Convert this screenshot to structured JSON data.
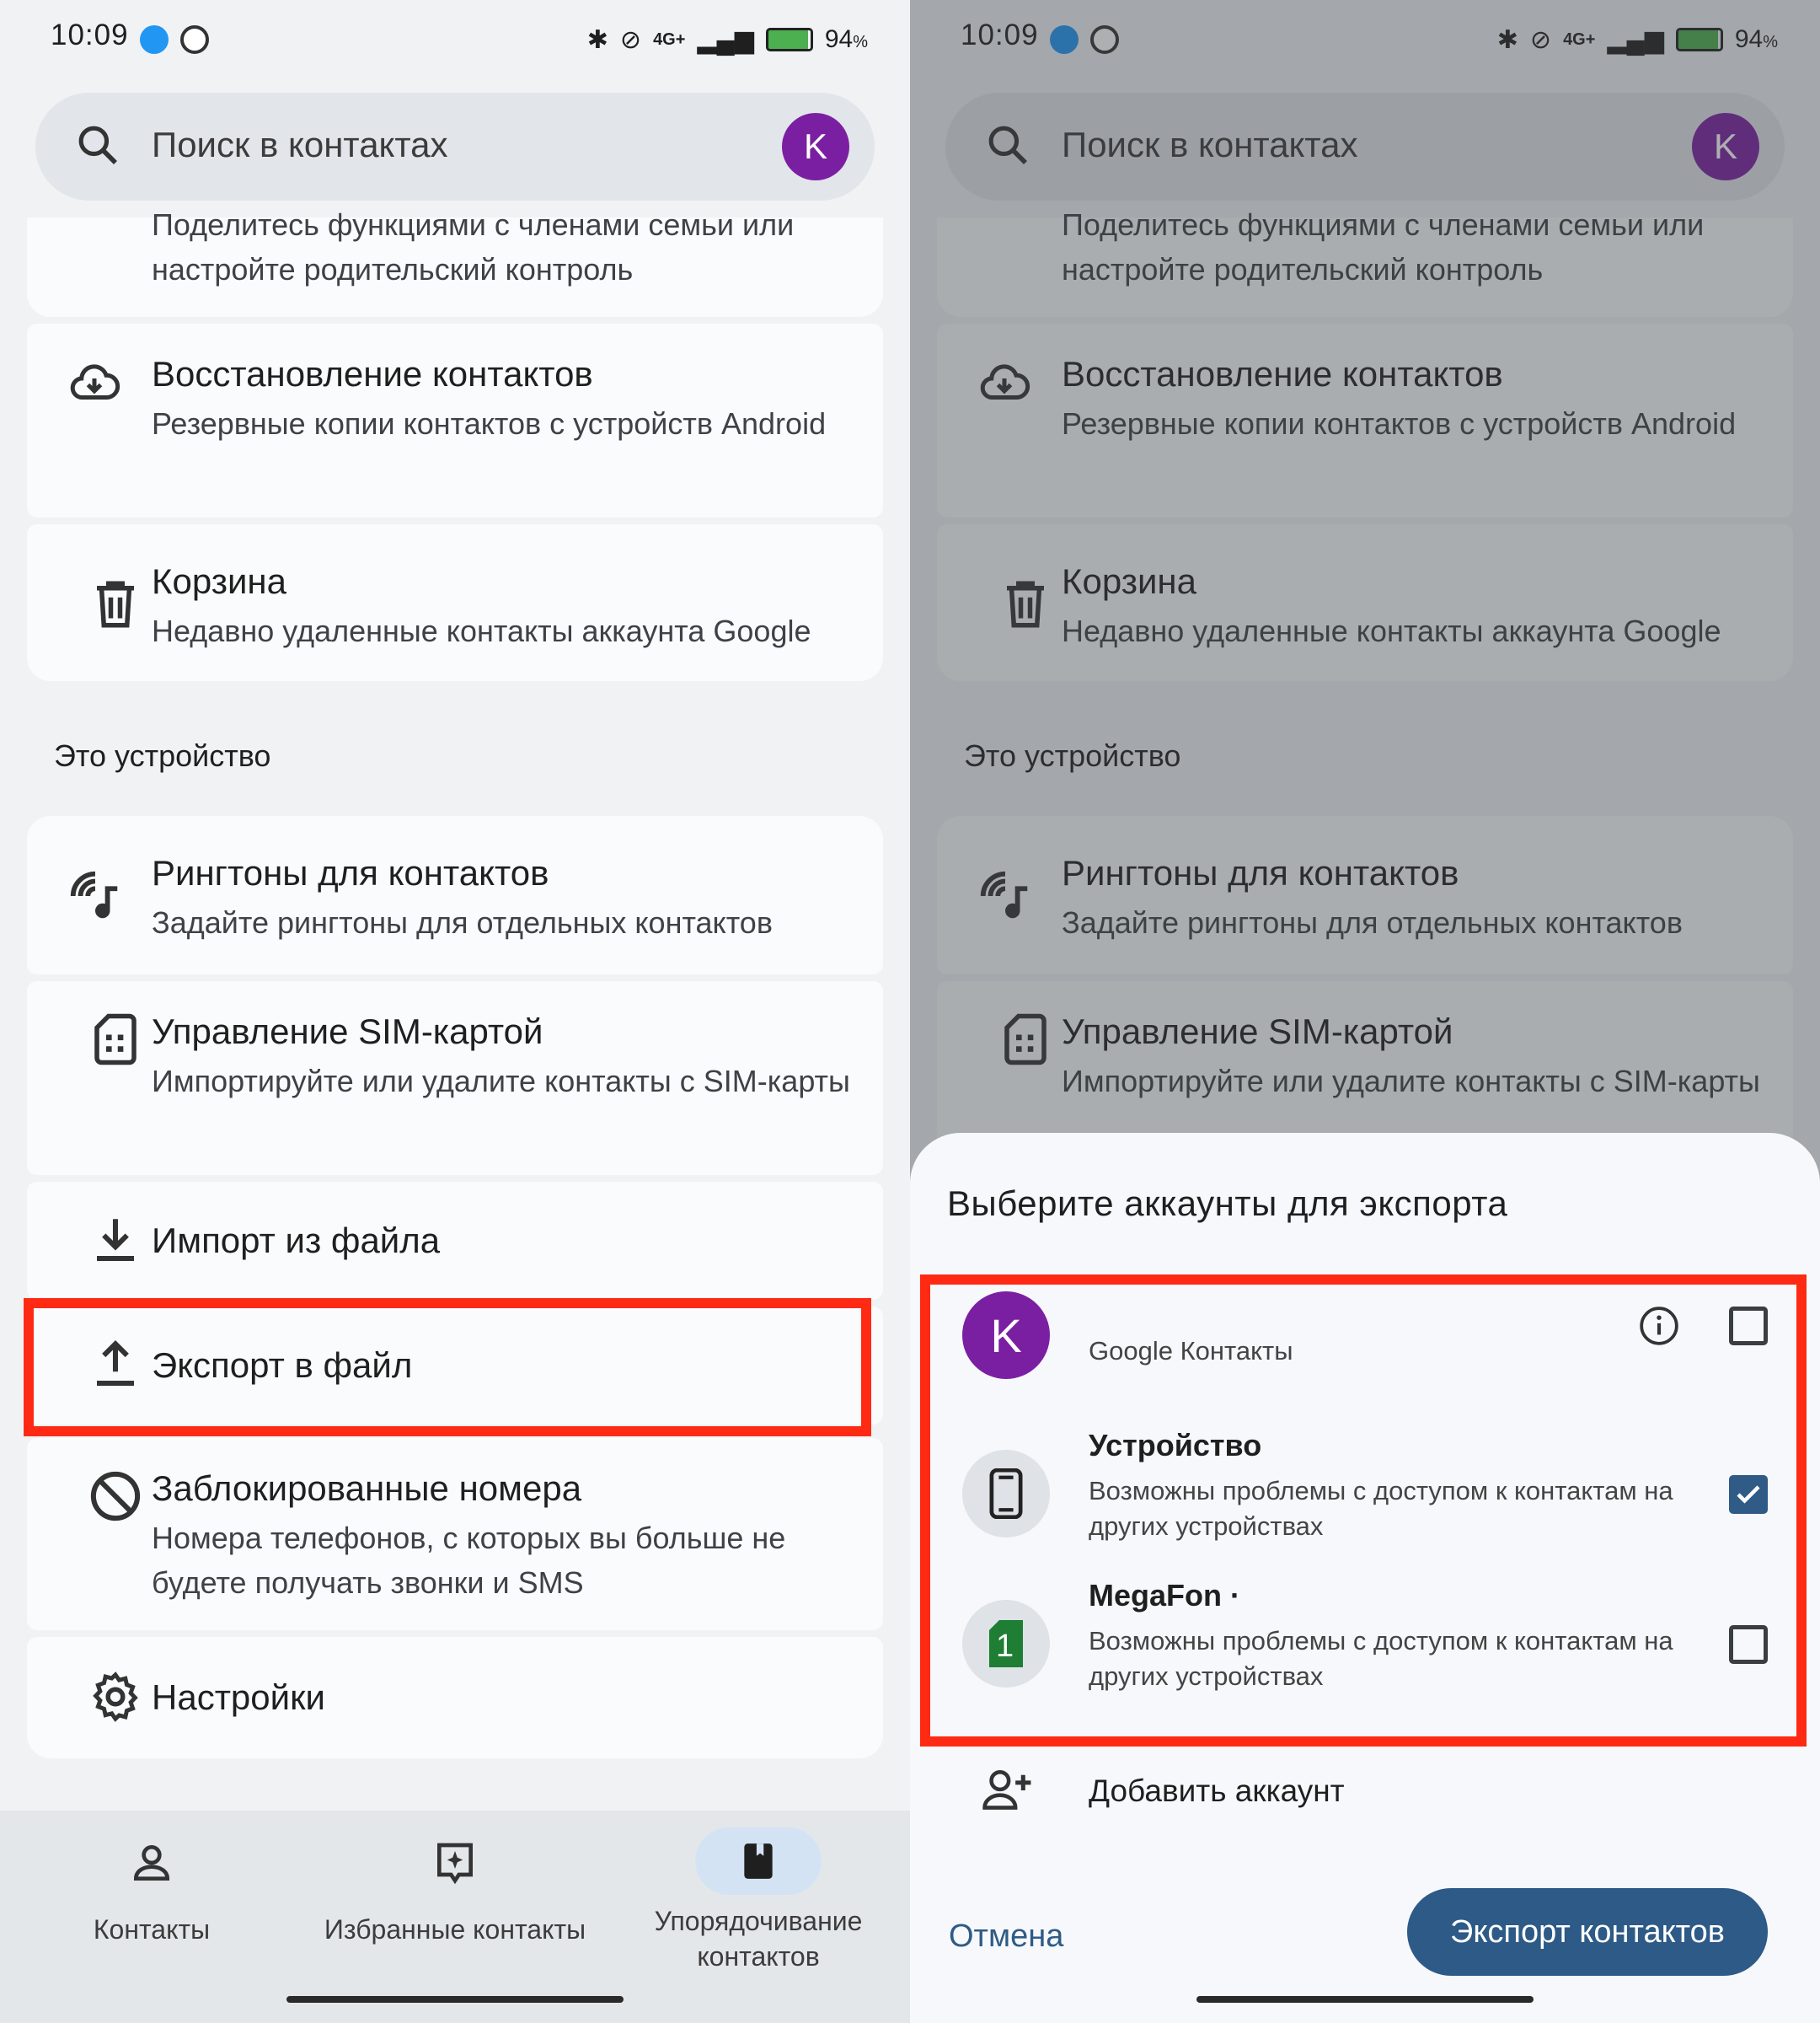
{
  "status_bar": {
    "time": "10:09",
    "battery": "94",
    "battery_unit": "%",
    "network": "4G+"
  },
  "search": {
    "placeholder": "Поиск в контактах",
    "avatar_letter": "K"
  },
  "list_top": {
    "family_sub_line1": "Поделитесь функциями с членами семьи или",
    "family_sub_line2": "настройте родительский контроль",
    "restore": {
      "title": "Восстановление контактов",
      "sub": "Резервные копии контактов с устройств Android"
    },
    "trash": {
      "title": "Корзина",
      "sub": "Недавно удаленные контакты аккаунта Google"
    }
  },
  "section_device": "Это устройство",
  "list_device": {
    "ringtones": {
      "title": "Рингтоны для контактов",
      "sub": "Задайте рингтоны для отдельных контактов"
    },
    "sim": {
      "title": "Управление SIM-картой",
      "sub": "Импортируйте или удалите контакты с SIM-карты"
    },
    "import": {
      "title": "Импорт из файла"
    },
    "export": {
      "title": "Экспорт в файл"
    },
    "blocked": {
      "title": "Заблокированные номера",
      "sub": "Номера телефонов, с которых вы больше не будете получать звонки и SMS"
    },
    "settings": {
      "title": "Настройки"
    }
  },
  "nav": {
    "contacts": "Контакты",
    "favorites": "Избранные контакты",
    "organize": "Упорядочивание контактов"
  },
  "dialog": {
    "title": "Выберите аккаунты для экспорта",
    "accounts": [
      {
        "letter": "K",
        "name": "",
        "sub": "Google Контакты",
        "checked": false
      },
      {
        "name": "Устройство",
        "sub": "Возможны проблемы с доступом к контактам на других устройствах",
        "checked": true
      },
      {
        "name": "MegaFon ·",
        "sim_number": "1",
        "sub": "Возможны проблемы с доступом к контактам на других устройствах",
        "checked": false
      }
    ],
    "add_account": "Добавить аккаунт",
    "cancel": "Отмена",
    "export": "Экспорт контактов"
  },
  "colors": {
    "accent": "#2d5a86",
    "avatar": "#7b1fa2",
    "highlight": "#ff2a14",
    "sim_green": "#1e7e34"
  }
}
